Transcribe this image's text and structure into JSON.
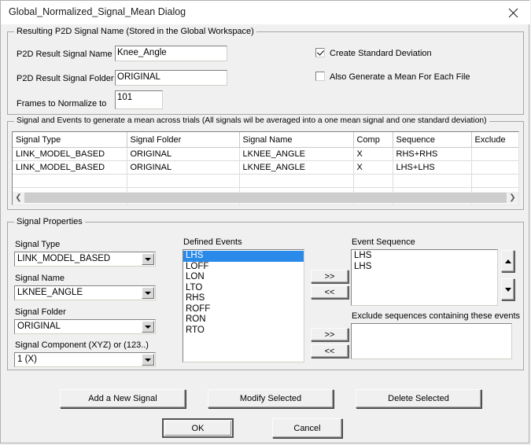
{
  "window": {
    "title": "Global_Normalized_Signal_Mean Dialog",
    "close_icon": "close-icon"
  },
  "result_group": {
    "title": "Resulting P2D Signal Name (Stored in the Global Workspace)",
    "fields": [
      {
        "label": "P2D Result Signal Name",
        "value": "Knee_Angle"
      },
      {
        "label": "P2D Result Signal Folder",
        "value": "ORIGINAL"
      },
      {
        "label": "Frames to Normalize to",
        "value": "101"
      }
    ],
    "checkboxes": [
      {
        "label": "Create Standard Deviation",
        "checked": true
      },
      {
        "label": "Also Generate a Mean For Each File",
        "checked": false
      }
    ]
  },
  "signal_events_group": {
    "title": "Signal and Events to generate a mean across trials (All signals wil be averaged into a one mean signal and one standard deviation)",
    "columns": [
      "Signal Type",
      "Signal Folder",
      "Signal Name",
      "Comp",
      "Sequence",
      "Exclude"
    ],
    "rows": [
      [
        "LINK_MODEL_BASED",
        "ORIGINAL",
        "LKNEE_ANGLE",
        "X",
        "RHS+RHS",
        ""
      ],
      [
        "LINK_MODEL_BASED",
        "ORIGINAL",
        "LKNEE_ANGLE",
        "X",
        "LHS+LHS",
        ""
      ],
      [
        "",
        "",
        "",
        "",
        "",
        ""
      ],
      [
        "",
        "",
        "",
        "",
        "",
        ""
      ],
      [
        "",
        "",
        "",
        "",
        "",
        ""
      ]
    ],
    "scrollbar": {
      "left_arrow": "chevron-left-icon",
      "right_arrow": "chevron-right-icon"
    }
  },
  "signal_properties": {
    "title": "Signal Properties",
    "combos": [
      {
        "label": "Signal Type",
        "value": "LINK_MODEL_BASED"
      },
      {
        "label": "Signal Name",
        "value": "LKNEE_ANGLE"
      },
      {
        "label": "Signal Folder",
        "value": "ORIGINAL"
      },
      {
        "label": "Signal Component (XYZ) or (123..)",
        "value": "1 (X)"
      }
    ],
    "defined_events": {
      "label": "Defined Events",
      "items": [
        "LHS",
        "LOFF",
        "LON",
        "LTO",
        "RHS",
        "ROFF",
        "RON",
        "RTO"
      ],
      "selected": "LHS"
    },
    "event_sequence": {
      "label": "Event Sequence",
      "items": [
        "LHS",
        "LHS"
      ],
      "scroll_up": "triangle-up-icon",
      "scroll_down": "triangle-down-icon"
    },
    "exclude_sequences": {
      "label": "Exclude sequences containing these events",
      "items": []
    },
    "transfer_buttons": {
      "seq_add": ">>",
      "seq_remove": "<<",
      "excl_add": ">>",
      "excl_remove": "<<"
    }
  },
  "actions": {
    "add_new_signal": "Add a New Signal",
    "modify_selected": "Modify Selected",
    "delete_selected": "Delete Selected",
    "ok": "OK",
    "cancel": "Cancel"
  }
}
